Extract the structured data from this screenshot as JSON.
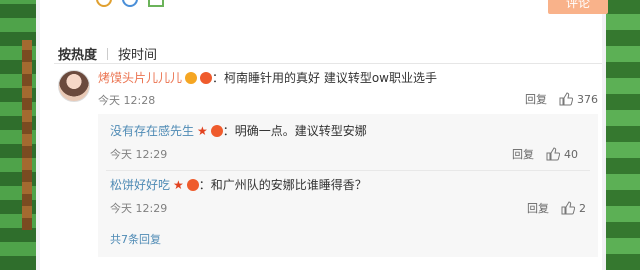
{
  "top_bar": {
    "obscured_text": "",
    "post_button_label": "评论"
  },
  "sort": {
    "by_heat": "按热度",
    "by_time": "按时间"
  },
  "comment": {
    "username": "烤馍头片儿儿儿",
    "text": "：柯南睡针用的真好 建议转型ow职业选手",
    "time": "今天 12:28",
    "reply_label": "回复",
    "likes": "376"
  },
  "replies": [
    {
      "username": "没有存在感先生",
      "text": "：明确一点。建议转型安娜",
      "time": "今天 12:29",
      "reply_label": "回复",
      "likes": "40"
    },
    {
      "username": "松饼好好吃",
      "text": "：和广州队的安娜比谁睡得香？",
      "time": "今天 12:29",
      "reply_label": "回复",
      "likes": "2"
    }
  ],
  "more_replies": "共7条回复",
  "colors": {
    "username_main": "#eb7350",
    "username_reply": "#4f8bb5",
    "post_button": "#f9b28a"
  }
}
